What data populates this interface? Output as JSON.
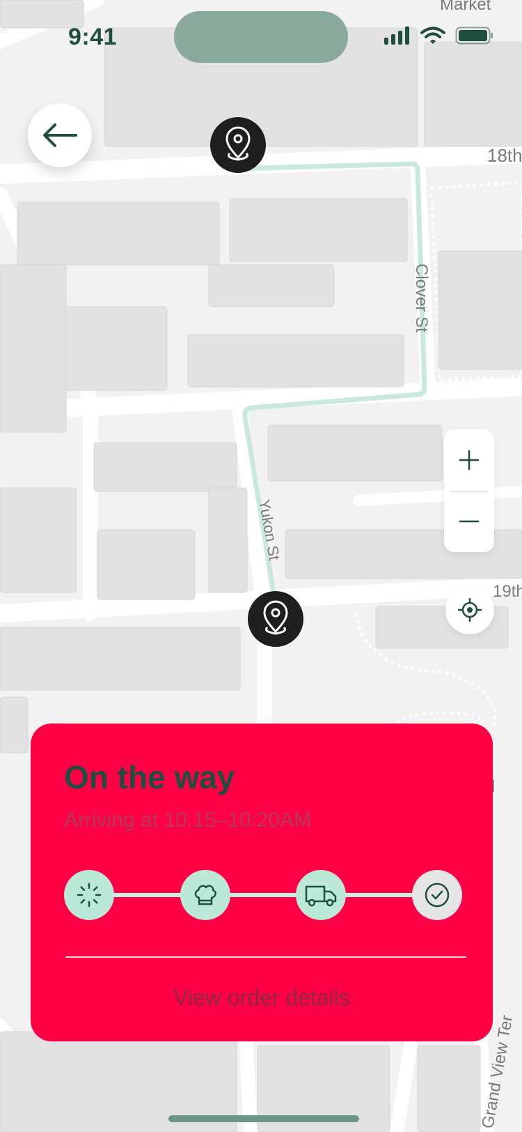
{
  "status_bar": {
    "time": "9:41"
  },
  "map": {
    "street_labels": {
      "market": "Market",
      "eighteenth": "18th",
      "nineteenth": "19th",
      "clover": "Clover St",
      "yukon": "Yukon St",
      "grand_view": "Grand View Ter",
      "partial_l": "l"
    },
    "route_color": "#c8e9dc",
    "pin_color": "#1e1e1e"
  },
  "controls": {
    "back_icon": "arrow-left-icon",
    "zoom_in_icon": "plus-icon",
    "zoom_out_icon": "minus-icon",
    "locate_icon": "crosshair-icon"
  },
  "order_status": {
    "title": "On the way",
    "subtitle": "Arriving at 10:15–10:20AM",
    "steps": [
      {
        "icon": "spinner-icon",
        "state": "complete"
      },
      {
        "icon": "chef-hat-icon",
        "state": "complete"
      },
      {
        "icon": "truck-icon",
        "state": "current"
      },
      {
        "icon": "check-circle-icon",
        "state": "pending"
      }
    ],
    "details_link": "View order details"
  },
  "colors": {
    "card_bg": "#ff0044",
    "accent_dark": "#1f4d3f",
    "step_bg": "#bce8d8"
  }
}
